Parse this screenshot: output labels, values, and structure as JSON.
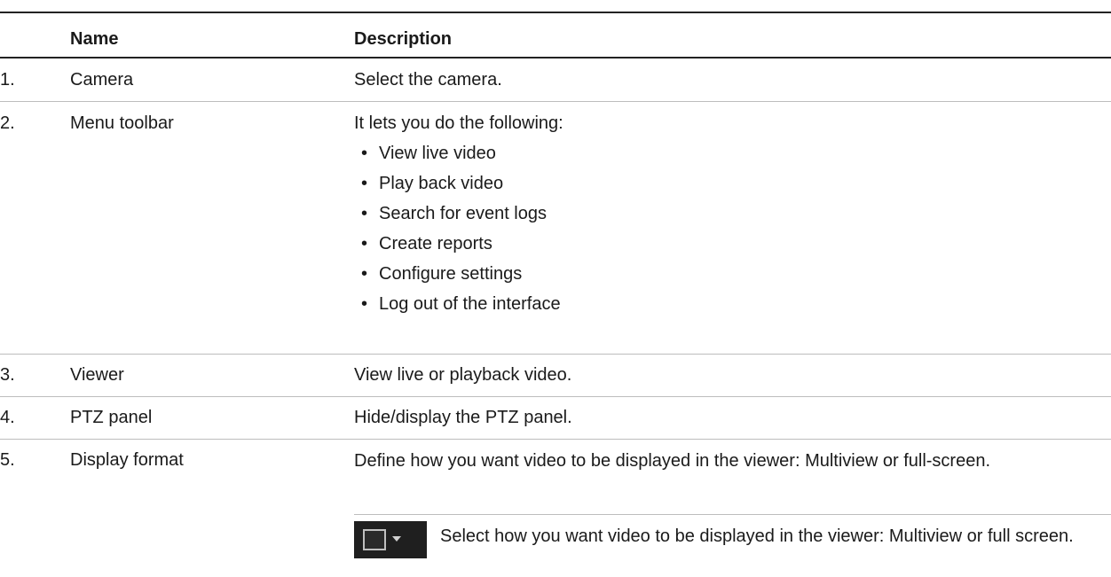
{
  "header": {
    "col_name": "Name",
    "col_description": "Description"
  },
  "rows": [
    {
      "num": "1.",
      "name": "Camera",
      "description": "Select the camera."
    },
    {
      "num": "2.",
      "name": "Menu toolbar",
      "description": "It lets you do the following:",
      "bullets": [
        "View live video",
        "Play back video",
        "Search for event logs",
        "Create reports",
        "Configure settings",
        "Log out of the interface"
      ]
    },
    {
      "num": "3.",
      "name": "Viewer",
      "description": "View live or playback video."
    },
    {
      "num": "4.",
      "name": "PTZ panel",
      "description": "Hide/display the PTZ panel."
    },
    {
      "num": "5.",
      "name": "Display format",
      "description": "Define how you want video to be displayed in the viewer: Multiview or full-screen.",
      "icon_name": "display-format-icon",
      "icon_description": "Select how you want video to be displayed in the viewer: Multiview or full screen."
    }
  ],
  "bullet_glyph": "•"
}
